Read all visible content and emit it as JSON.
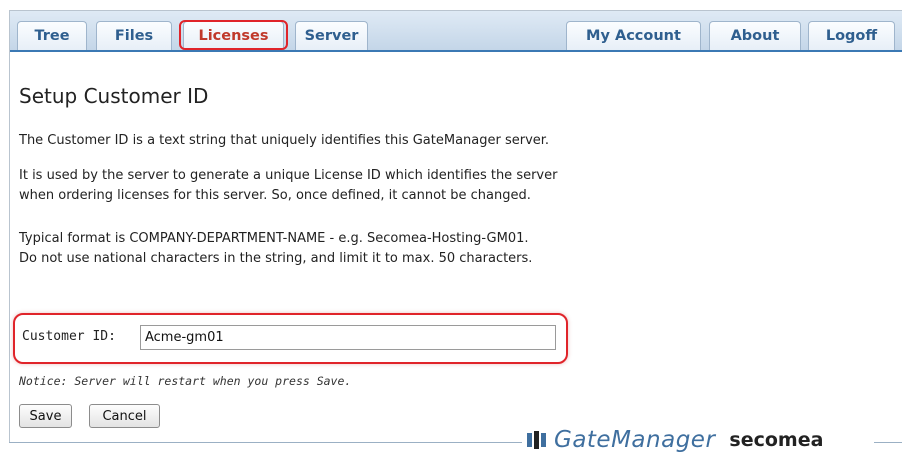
{
  "nav": {
    "left_tabs": [
      {
        "label": "Tree"
      },
      {
        "label": "Files"
      },
      {
        "label": "Licenses"
      },
      {
        "label": "Server"
      }
    ],
    "right_tabs": [
      {
        "label": "My Account"
      },
      {
        "label": "About"
      },
      {
        "label": "Logoff"
      }
    ],
    "selected": "Licenses"
  },
  "page": {
    "title": "Setup Customer ID",
    "p1": "The Customer ID is a text string that uniquely identifies this GateManager server.",
    "p2_line1": "It is used by the server to generate a unique License ID which identifies the server",
    "p2_line2": "when ordering licenses for this server. So, once defined, it cannot be changed.",
    "p3_line1": "Typical format is COMPANY-DEPARTMENT-NAME - e.g. Secomea-Hosting-GM01.",
    "p3_line2": "Do not use national characters in the string, and limit it to max. 50 characters."
  },
  "form": {
    "customer_id_label": "Customer ID:",
    "customer_id_value": "Acme-gm01",
    "notice": "Notice: Server will restart when you press Save.",
    "save_label": "Save",
    "cancel_label": "Cancel"
  },
  "footer": {
    "product": "GateManager",
    "brand": "secomea"
  },
  "colors": {
    "tab_text": "#2f5f8f",
    "highlight": "#e0242a",
    "tabbar_border": "#3b79b4"
  }
}
